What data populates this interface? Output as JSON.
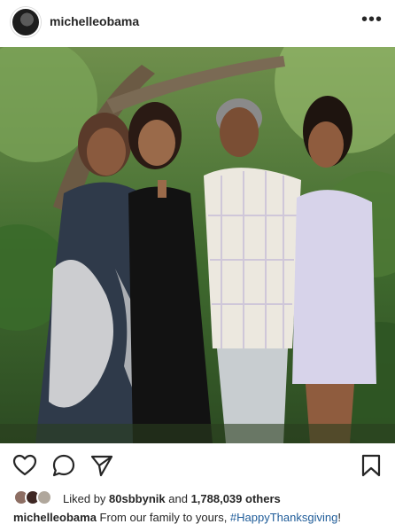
{
  "post": {
    "username": "michelleobama",
    "more_icon": "more-icon",
    "photo_alt": "Family photo"
  },
  "actions": {
    "like_icon": "heart-icon",
    "comment_icon": "comment-icon",
    "share_icon": "send-icon",
    "save_icon": "bookmark-icon"
  },
  "likes": {
    "prefix": "Liked by ",
    "user": "80sbbynik",
    "joiner": " and ",
    "count": "1,788,039 others"
  },
  "caption": {
    "username": "michelleobama",
    "text": " From our family to yours, ",
    "hashtag": "#HappyThanksgiving",
    "suffix": "!"
  },
  "colors": {
    "hashtag": "#1f5c99",
    "text": "#262626"
  }
}
